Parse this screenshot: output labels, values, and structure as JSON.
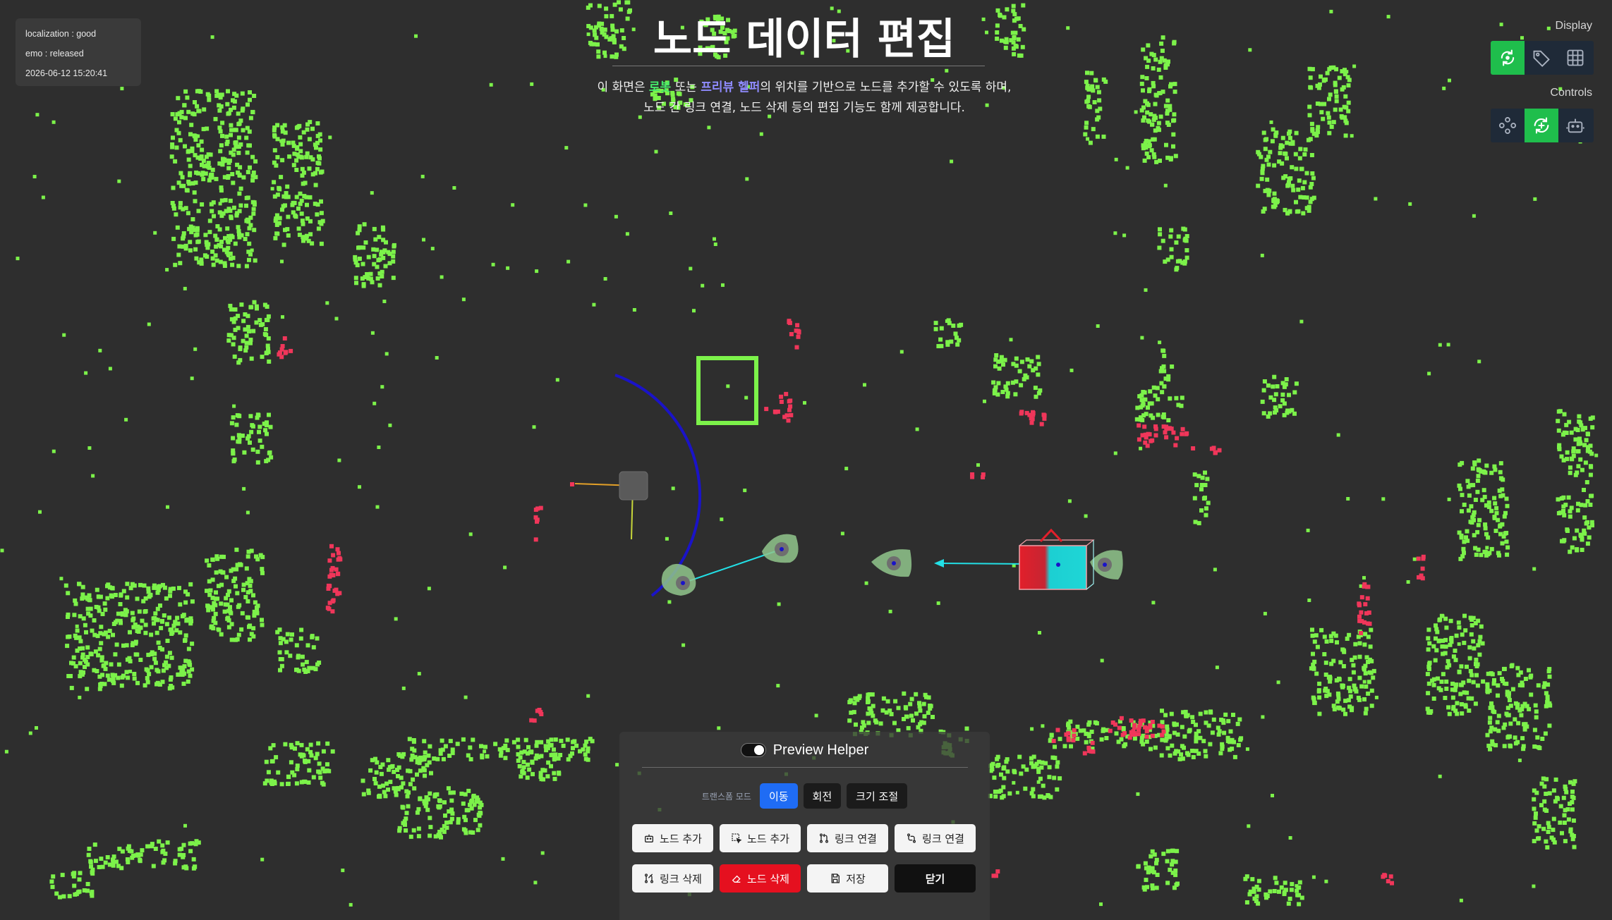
{
  "status": {
    "localization": "localization : good",
    "emo": "emo : released",
    "datetime": "2026-06-12 15:20:41"
  },
  "header": {
    "title": "노드 데이터 편집",
    "subtitle_line1_prefix": "이 화면은 ",
    "subtitle_robot": "로봇",
    "subtitle_mid": " 또는 ",
    "subtitle_preview": "프리뷰 헬퍼",
    "subtitle_line1_suffix": "의 위치를 기반으로 노드를 추가할 수 있도록 하며,",
    "subtitle_line2": "노드 간 링크 연결, 노드 삭제 등의 편집 기능도 함께 제공합니다."
  },
  "display": {
    "label": "Display",
    "icons": [
      "wifi-sync-icon",
      "tag-icon",
      "grid-icon"
    ]
  },
  "controls": {
    "label": "Controls",
    "icons": [
      "gamepad-icon",
      "rotate-arrows-icon",
      "robot-icon"
    ]
  },
  "panel": {
    "preview_label": "Preview Helper",
    "mode_label": "트랜스폼 모드",
    "modes": [
      "이동",
      "회전",
      "크기 조절"
    ],
    "actions": {
      "add_node_robot": "노드 추가",
      "add_node_preview": "노드 추가",
      "link_connect_1": "링크 연결",
      "link_connect_2": "링크 연결",
      "link_delete": "링크 삭제",
      "node_delete": "노드 삭제",
      "save": "저장",
      "close": "닫기"
    }
  },
  "colors": {
    "background": "#2e2e2e",
    "points_green": "#7cf24a",
    "points_red": "#f0365a",
    "accent_green": "#1fbe4c",
    "accent_blue": "#1f6cf4",
    "danger": "#e5101f",
    "arc_blue": "#1a13c8",
    "link_cyan": "#22e0e6"
  }
}
